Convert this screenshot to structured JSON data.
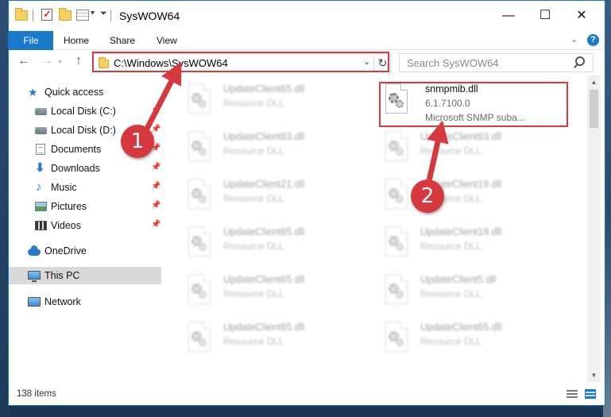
{
  "window": {
    "title": "SysWOW64",
    "controls": {
      "minimize": "—",
      "maximize": "☐",
      "close": "✕"
    }
  },
  "ribbon": {
    "tabs": [
      "File",
      "Home",
      "Share",
      "View"
    ],
    "collapse_glyph": "⌄",
    "help_glyph": "?"
  },
  "navigation": {
    "back_glyph": "←",
    "forward_glyph": "→",
    "up_glyph": "↑",
    "address": "C:\\Windows\\SysWOW64",
    "refresh_glyph": "↻",
    "search_placeholder": "Search SysWOW64"
  },
  "sidebar": {
    "items": [
      {
        "label": "Quick access",
        "icon": "star-icon",
        "pinned": false
      },
      {
        "label": "Local Disk (C:)",
        "icon": "drive-icon",
        "pinned": true
      },
      {
        "label": "Local Disk (D:)",
        "icon": "drive-icon",
        "pinned": true
      },
      {
        "label": "Documents",
        "icon": "documents-icon",
        "pinned": true
      },
      {
        "label": "Downloads",
        "icon": "download-icon",
        "pinned": true
      },
      {
        "label": "Music",
        "icon": "music-icon",
        "pinned": true
      },
      {
        "label": "Pictures",
        "icon": "pictures-icon",
        "pinned": true
      },
      {
        "label": "Videos",
        "icon": "videos-icon",
        "pinned": true
      },
      {
        "label": "OneDrive",
        "icon": "onedrive-icon",
        "pinned": false
      },
      {
        "label": "This PC",
        "icon": "this-pc-icon",
        "pinned": false,
        "selected": true
      },
      {
        "label": "Network",
        "icon": "network-icon",
        "pinned": false
      }
    ],
    "pin_glyph": "📌"
  },
  "files": {
    "left_column": [
      {
        "name": "UpdateClient65.dll",
        "type": "Resource DLL"
      },
      {
        "name": "UpdateClient63.dll",
        "type": "Resource DLL"
      },
      {
        "name": "UpdateClient21.dll",
        "type": "Resource DLL"
      },
      {
        "name": "UpdateClient65.dll",
        "type": "Resource DLL"
      },
      {
        "name": "UpdateClient65.dll",
        "type": "Resource DLL"
      },
      {
        "name": "UpdateClient65.dll",
        "type": "Resource DLL"
      }
    ],
    "right_column": [
      {
        "name": "snmpmib.dll",
        "type": "6.1.7100.0",
        "description": "Microsoft SNMP suba..."
      },
      {
        "name": "UpdateClient63.dll",
        "type": "Resource DLL"
      },
      {
        "name": "UpdateClient19.dll",
        "type": "Resource DLL"
      },
      {
        "name": "UpdateClient19.dll",
        "type": "Resource DLL"
      },
      {
        "name": "UpdateClient5.dll",
        "type": "Resource DLL"
      },
      {
        "name": "UpdateClient65.dll",
        "type": "Resource DLL"
      }
    ]
  },
  "status": {
    "item_count": "138 items"
  },
  "annotations": {
    "step1": "1",
    "step2": "2",
    "color": "#d6393d"
  },
  "colors": {
    "accent": "#1979ca",
    "highlight_border": "#d9393f"
  }
}
